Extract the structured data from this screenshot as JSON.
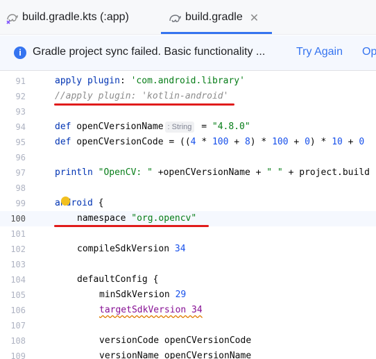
{
  "tabs": [
    {
      "label": "build.gradle.kts (:app)",
      "icon": "gradle-kts-icon",
      "active": false
    },
    {
      "label": "build.gradle",
      "icon": "gradle-icon",
      "active": true
    }
  ],
  "banner": {
    "message": "Gradle project sync failed. Basic functionality ...",
    "try_again": "Try Again",
    "open": "Op"
  },
  "editor": {
    "current_line": "100",
    "lines": [
      {
        "num": "91",
        "code": "apply plugin: 'com.android.library'"
      },
      {
        "num": "92",
        "code": "//apply plugin: 'kotlin-android'"
      },
      {
        "num": "93",
        "code": ""
      },
      {
        "num": "94",
        "code": "def openCVersionName",
        "hint": ": String",
        "code_rest": " = \"4.8.0\""
      },
      {
        "num": "95",
        "code": "def openCVersionCode = ((4 * 100 + 8) * 100 + 0) * 10 + 0"
      },
      {
        "num": "96",
        "code": ""
      },
      {
        "num": "97",
        "code": "println \"OpenCV: \" +openCVersionName + \" \" + project.build"
      },
      {
        "num": "98",
        "code": ""
      },
      {
        "num": "99",
        "code": "android {"
      },
      {
        "num": "100",
        "code": "namespace \"org.opencv\""
      },
      {
        "num": "101",
        "code": ""
      },
      {
        "num": "102",
        "code": "compileSdkVersion 34"
      },
      {
        "num": "103",
        "code": ""
      },
      {
        "num": "104",
        "code": "defaultConfig {"
      },
      {
        "num": "105",
        "code": "minSdkVersion 29"
      },
      {
        "num": "106",
        "code": "targetSdkVersion 34"
      },
      {
        "num": "107",
        "code": ""
      },
      {
        "num": "108",
        "code": "versionCode openCVersionCode"
      },
      {
        "num": "109",
        "code": "versionName openCVersionName"
      }
    ]
  },
  "colors": {
    "accent": "#3574f0",
    "annotation_red": "#e01b1b",
    "keyword": "#0033b3",
    "string": "#067d17",
    "number": "#1750eb"
  }
}
